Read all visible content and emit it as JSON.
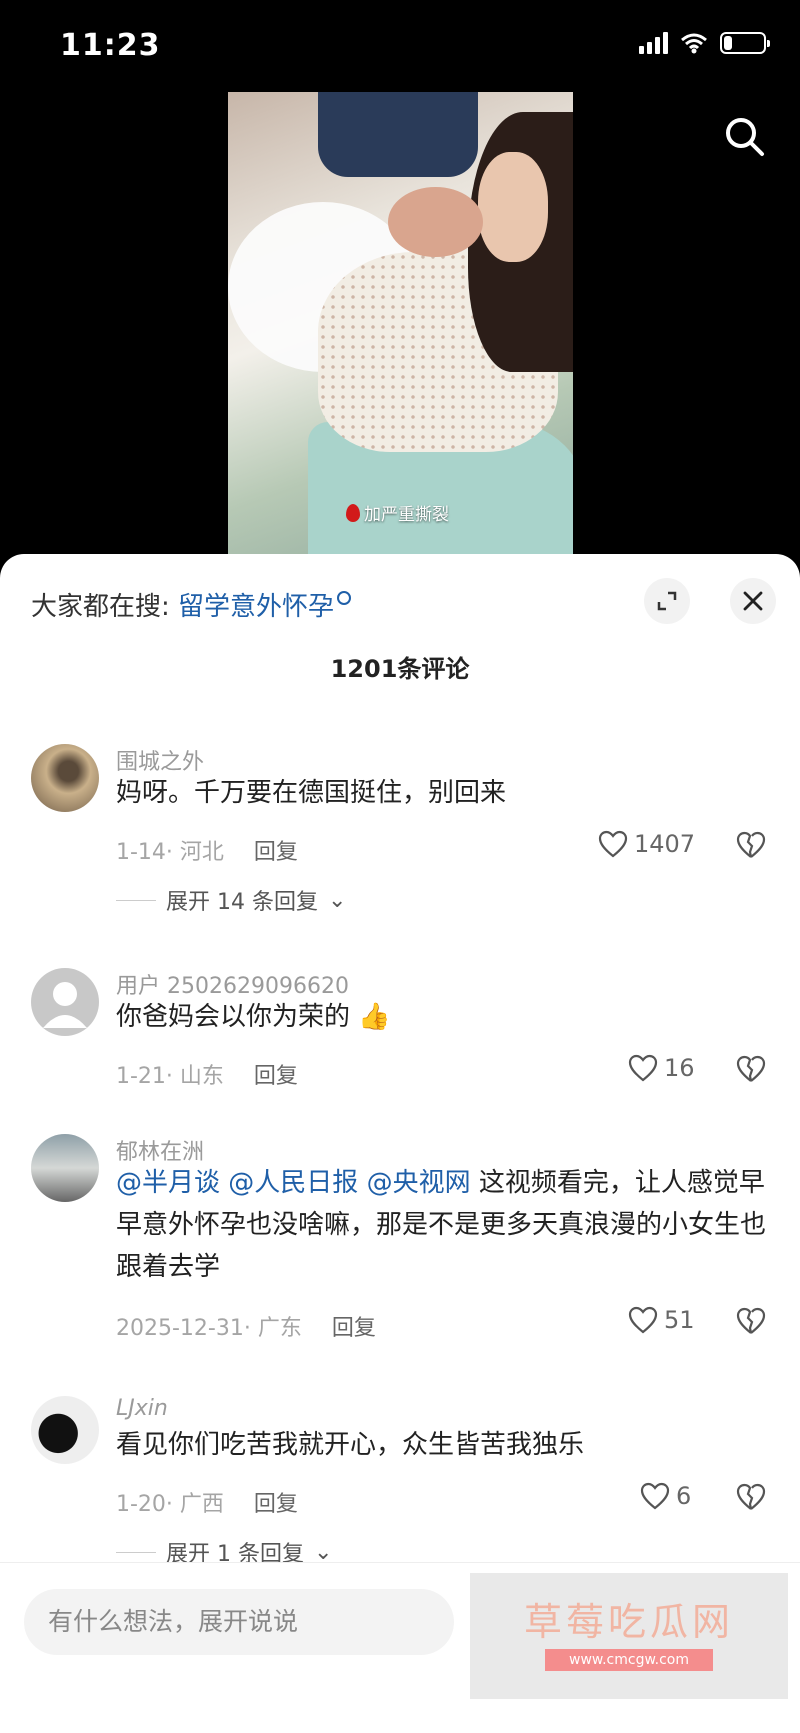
{
  "status": {
    "time": "11:23",
    "battery_percent": 0.2
  },
  "video": {
    "tag": "加严重撕裂"
  },
  "panel": {
    "trend_prefix": "大家都在搜: ",
    "trend_keyword": "留学意外怀孕",
    "comment_count": "1201条评论"
  },
  "comments": [
    {
      "user": "围城之外",
      "text": "妈呀。千万要在德国挺住，别回来",
      "meta": "1-14· 河北",
      "reply": "回复",
      "likes": "1407",
      "expand": "展开 14 条回复"
    },
    {
      "user": "用户 2502629096620",
      "text": "你爸妈会以你为荣的",
      "emoji": "👍",
      "meta": "1-21· 山东",
      "reply": "回复",
      "likes": "16"
    },
    {
      "user": "郁林在洲",
      "mentions": [
        "@半月谈",
        "@人民日报",
        "@央视网"
      ],
      "text": " 这视频看完，让人感觉早早意外怀孕也没啥嘛，那是不是更多天真浪漫的小女生也跟着去学",
      "meta": "2025-12-31· 广东",
      "reply": "回复",
      "likes": "51"
    },
    {
      "user": "LJxin",
      "text": "看见你们吃苦我就开心，众生皆苦我独乐",
      "meta": "1-20· 广西",
      "reply": "回复",
      "likes": "6",
      "expand": "展开 1 条回复"
    }
  ],
  "input": {
    "placeholder": "有什么想法，展开说说"
  },
  "watermark": {
    "title": "草莓吃瓜网",
    "url": "www.cmcgw.com"
  }
}
